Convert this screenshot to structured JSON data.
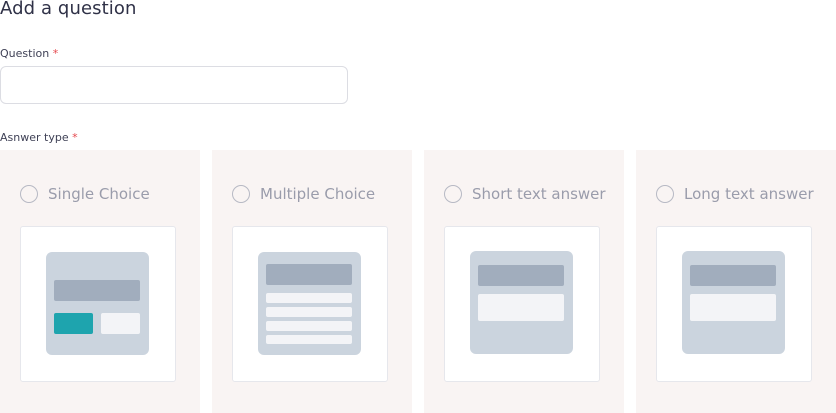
{
  "page": {
    "title": "Add a question"
  },
  "question": {
    "label": "Question",
    "required_mark": "*",
    "value": ""
  },
  "answer_type": {
    "label": "Asnwer type",
    "required_mark": "*",
    "options": [
      {
        "label": "Single Choice",
        "selected": false
      },
      {
        "label": "Multiple Choice",
        "selected": false
      },
      {
        "label": "Short text answer",
        "selected": false
      },
      {
        "label": "Long text answer",
        "selected": false
      }
    ]
  },
  "colors": {
    "accent": "#1ea4ae",
    "required": "#e5484d",
    "card_bg": "#f9f4f3",
    "illustration_bg": "#cbd4de"
  },
  "icons": [
    "radio-unchecked-icon",
    "single-choice-illustration",
    "multiple-choice-illustration",
    "short-text-illustration",
    "long-text-illustration"
  ]
}
